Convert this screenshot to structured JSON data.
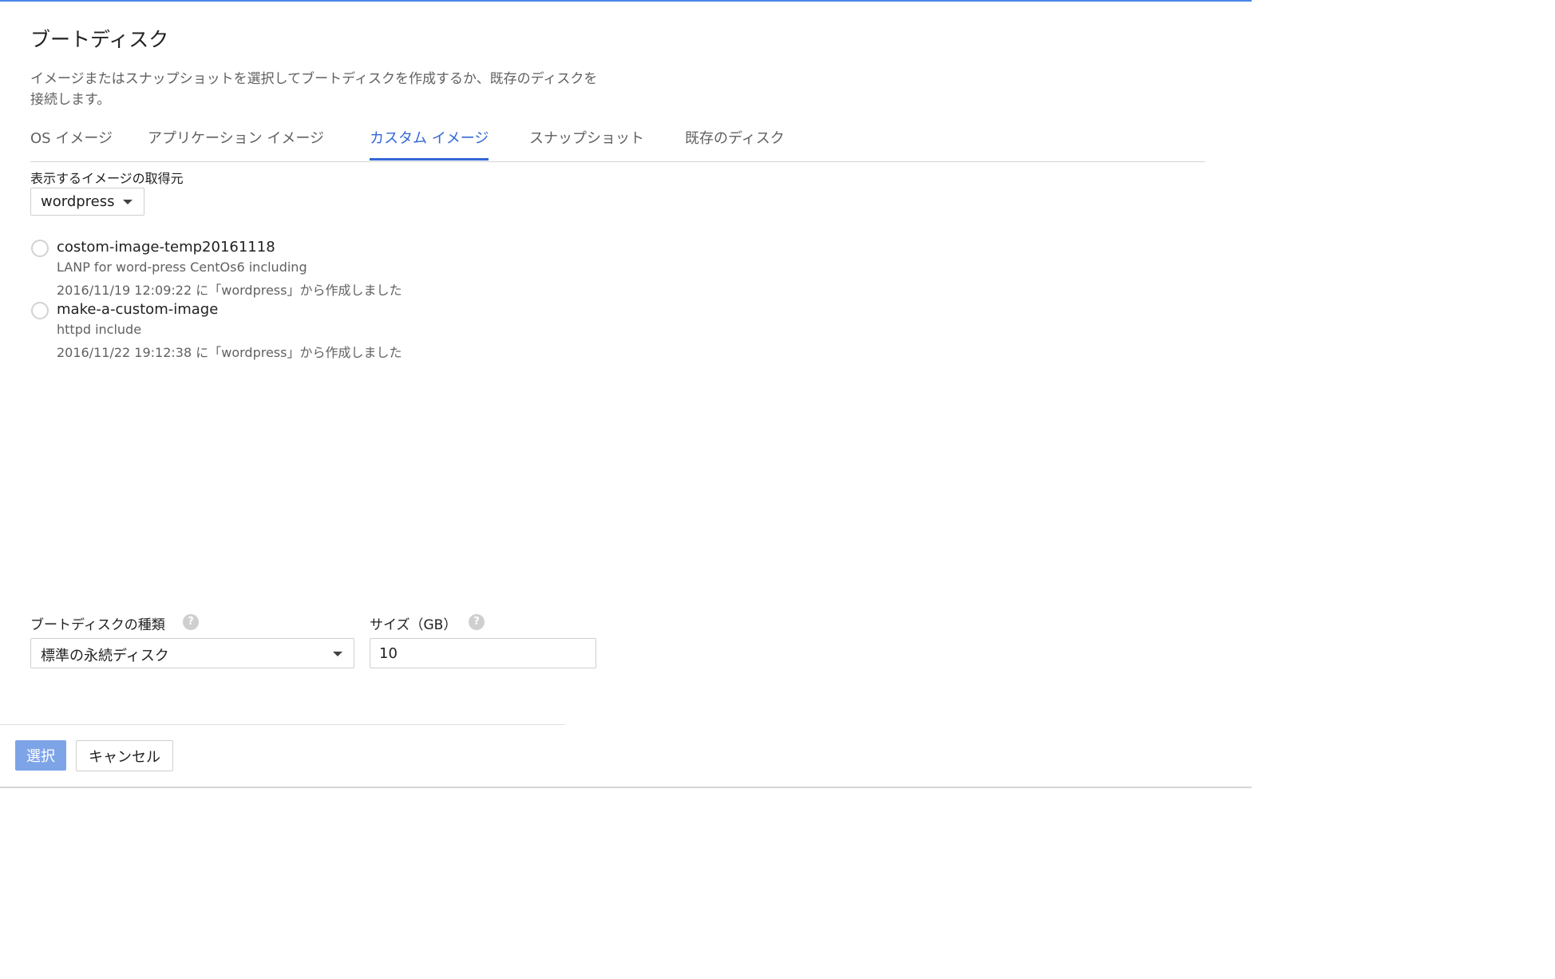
{
  "dialog": {
    "title": "ブートディスク",
    "description": "イメージまたはスナップショットを選択してブートディスクを作成するか、既存のディスクを接続します。"
  },
  "tabs": [
    {
      "label": "OS イメージ",
      "active": false
    },
    {
      "label": "アプリケーション イメージ",
      "active": false
    },
    {
      "label": "カスタム イメージ",
      "active": true
    },
    {
      "label": "スナップショット",
      "active": false
    },
    {
      "label": "既存のディスク",
      "active": false
    }
  ],
  "image_source": {
    "label": "表示するイメージの取得元",
    "selected": "wordpress"
  },
  "images": [
    {
      "name": "costom-image-temp20161118",
      "description": "LANP for word-press CentOs6 including",
      "created": "2016/11/19 12:09:22 に「wordpress」から作成しました",
      "selected": false
    },
    {
      "name": "make-a-custom-image",
      "description": "httpd include",
      "created": "2016/11/22 19:12:38 に「wordpress」から作成しました",
      "selected": false
    }
  ],
  "disk_type": {
    "label": "ブートディスクの種類",
    "selected": "標準の永続ディスク",
    "help_icon": "question-circle-icon"
  },
  "size": {
    "label": "サイズ（GB）",
    "value": "10",
    "help_icon": "question-circle-icon"
  },
  "buttons": {
    "select_label": "選択",
    "cancel_label": "キャンセル"
  },
  "colors": {
    "accent": "#3367d6",
    "top_bar": "#4a86e8",
    "primary_button_disabled": "#7ea4e8"
  }
}
